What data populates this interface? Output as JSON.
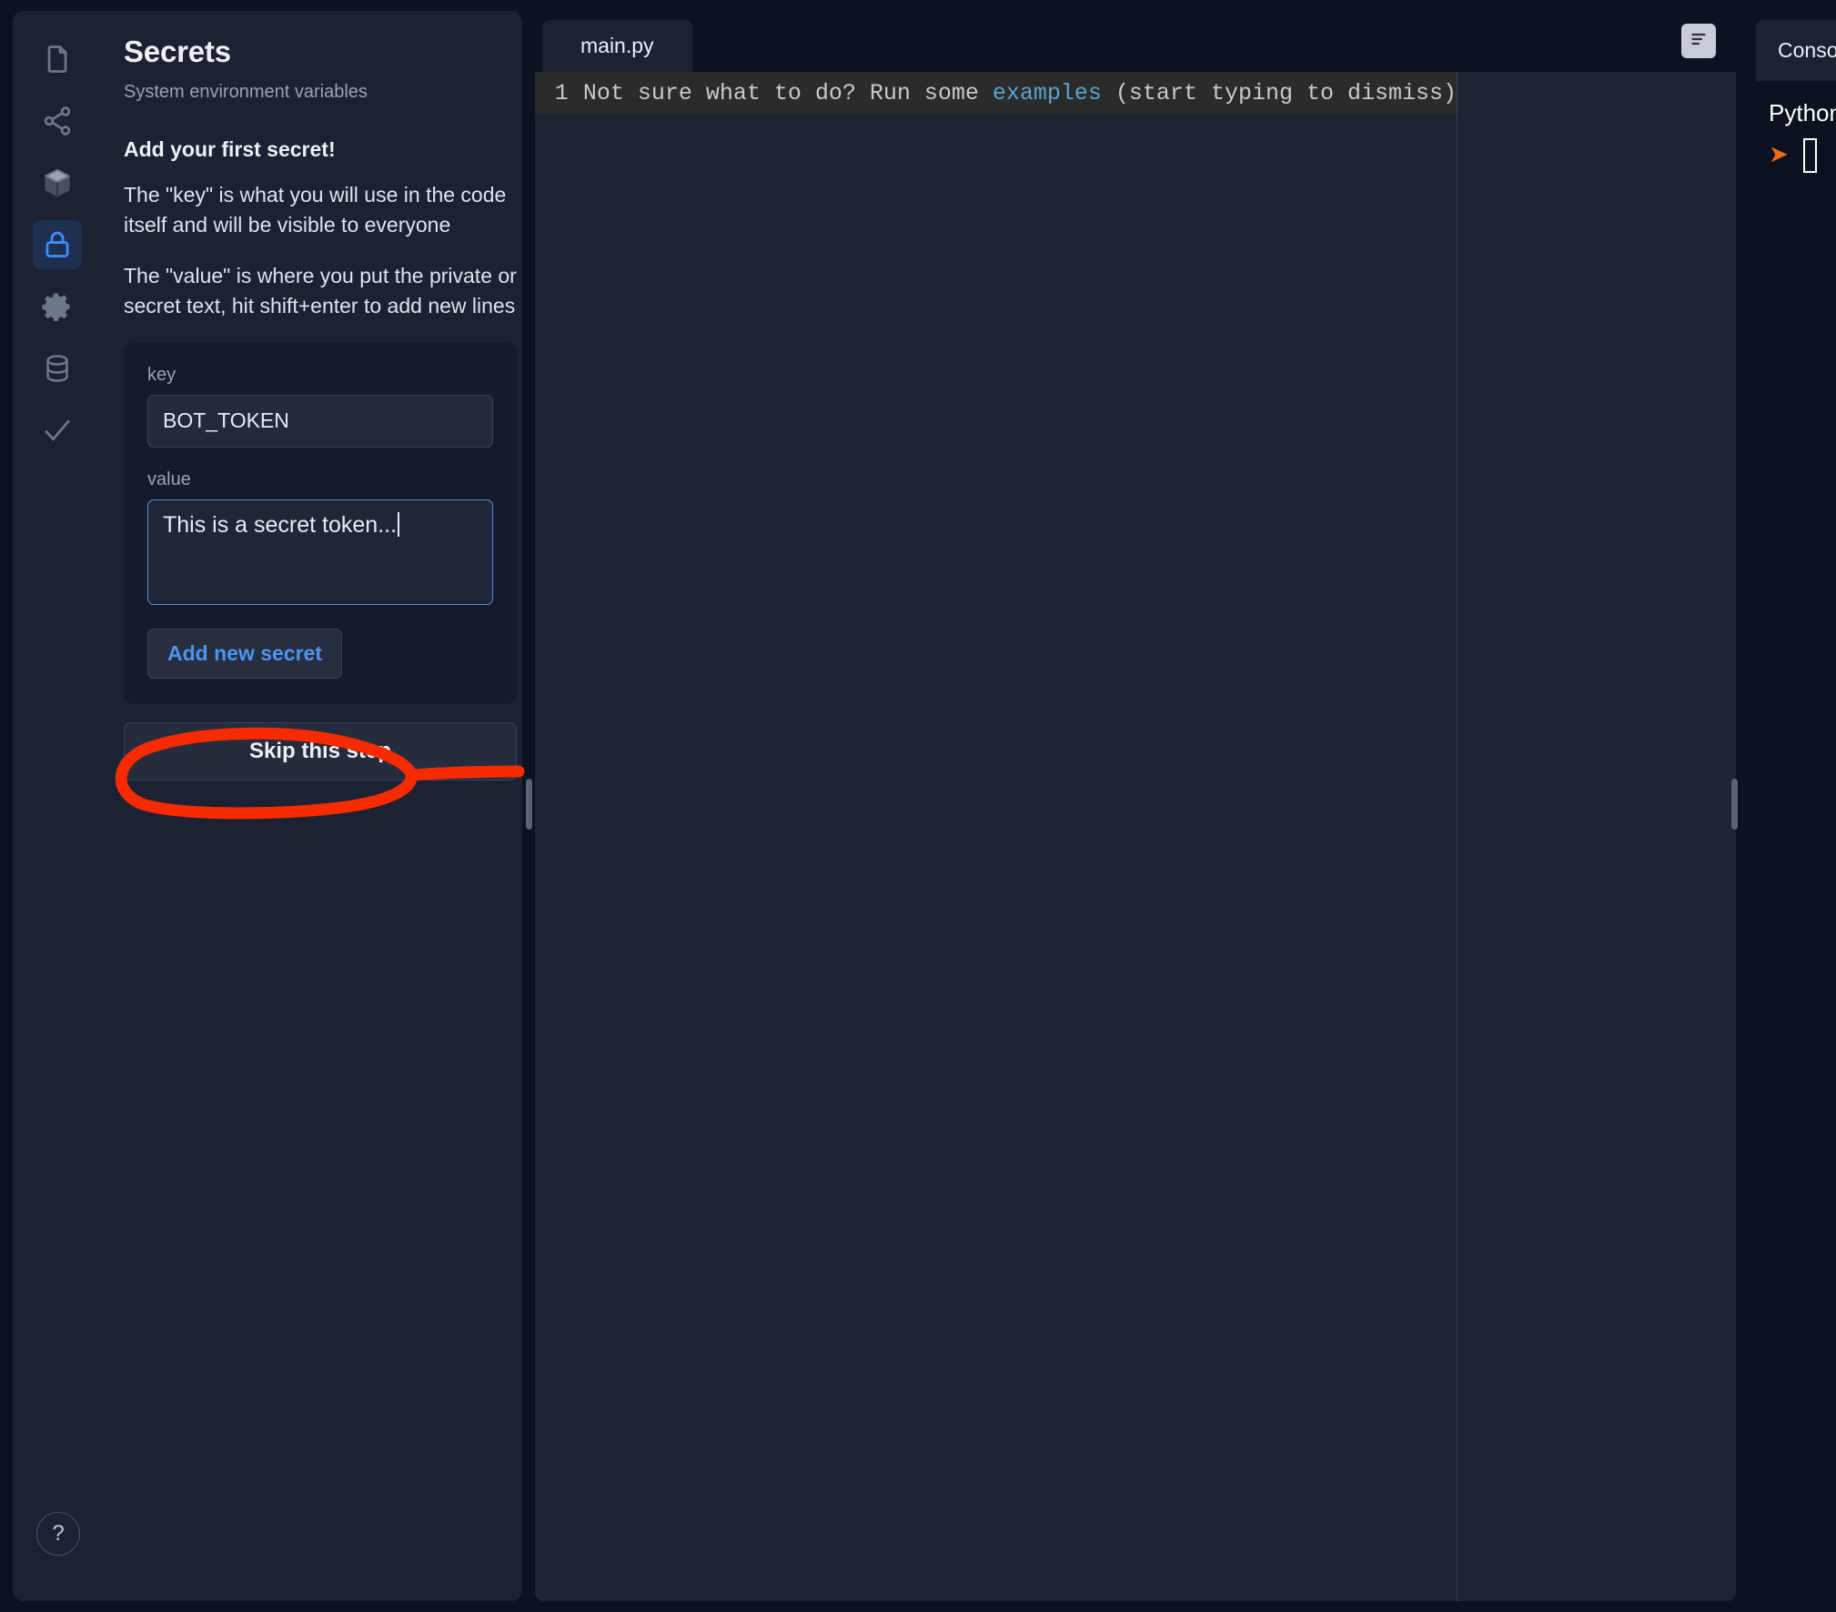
{
  "theme": {
    "app_background": "#0d1220",
    "panel_background": "#1c2234",
    "editor_background": "#1e2434",
    "accent_blue": "#4d94f0",
    "focus_border": "#4a90e2",
    "annotation_red": "#f62b00",
    "prompt_orange": "#ef6c1a",
    "muted_text": "#9aa3b2"
  },
  "sidebar_rail": {
    "items": [
      {
        "icon": "file-icon",
        "name": "files",
        "active": false
      },
      {
        "icon": "share-nodes-icon",
        "name": "version-control",
        "active": false
      },
      {
        "icon": "package-icon",
        "name": "packages",
        "active": false
      },
      {
        "icon": "lock-icon",
        "name": "secrets",
        "active": true
      },
      {
        "icon": "gear-icon",
        "name": "settings",
        "active": false
      },
      {
        "icon": "database-icon",
        "name": "database",
        "active": false
      },
      {
        "icon": "check-icon",
        "name": "checks",
        "active": false
      }
    ],
    "help_label": "?"
  },
  "secrets_panel": {
    "title": "Secrets",
    "subtitle": "System environment variables",
    "heading": "Add your first secret!",
    "paragraph_key": "The \"key\" is what you will use in the code itself and will be visible to everyone",
    "paragraph_value": "The \"value\" is where you put the private or secret text, hit shift+enter to add new lines",
    "form": {
      "key_label": "key",
      "key_value": "BOT_TOKEN",
      "key_placeholder": "key",
      "value_label": "value",
      "value_value": "This is a secret token...",
      "value_placeholder": "value",
      "add_button_label": "Add new secret"
    },
    "skip_button_label": "Skip this step"
  },
  "editor": {
    "tab_label": "main.py",
    "tab_action_icon": "document-outline-icon",
    "line_number": "1",
    "ghost_prefix": "Not sure what to do? Run some ",
    "ghost_link": "examples",
    "ghost_suffix": " (start typing to dismiss)"
  },
  "console": {
    "tab_label": "Console",
    "language_label": "Python",
    "prompt_symbol": "prompt-arrow-icon"
  },
  "annotation": {
    "shape": "hand-drawn-red-circle-with-arrow",
    "target": "Add new secret"
  }
}
